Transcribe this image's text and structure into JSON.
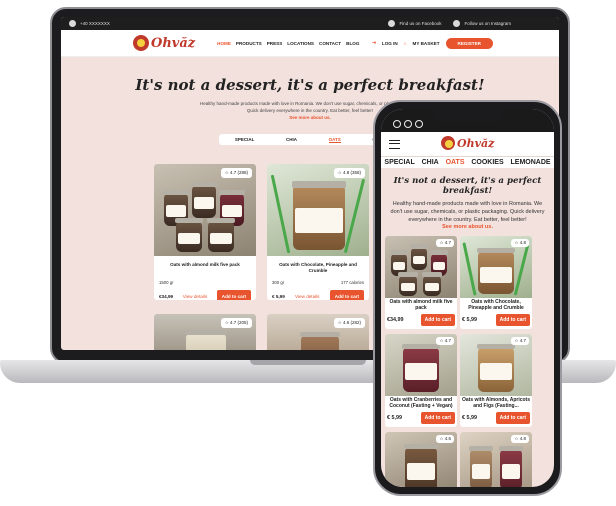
{
  "laptop": {
    "topbar": {
      "phone": "+40 XXXXXXX",
      "facebook": "Find us on Facebook",
      "instagram": "Follow us on Instagram"
    },
    "brand": "Ohvăz",
    "nav": [
      "HOME",
      "PRODUCTS",
      "PRESS",
      "LOCATIONS",
      "CONTACT",
      "BLOG"
    ],
    "nav_active": "HOME",
    "login": "LOG IN",
    "basket": "MY BASKET",
    "register": "REGISTER",
    "hero_title": "It's not a dessert, it's a perfect breakfast!",
    "hero_sub": "Healthy hand-made products made with love in Romania. We don't use sugar, chemicals, or plastic packaging. Quick delivery everywhere in the country. Eat better, feel better!",
    "hero_link": "See more about us.",
    "tabs": [
      "SPECIAL",
      "CHIA",
      "OATS",
      "COOKIES"
    ],
    "tab_active": "OATS",
    "cards": [
      {
        "rating": "4.7 (288)",
        "name": "Oats with almond milk five pack",
        "weight": "1500 gr",
        "calories": "",
        "price": "€34,99",
        "details": "View details",
        "add": "Add to cart"
      },
      {
        "rating": "4.8 (358)",
        "name": "Oats with Chocolate, Pineapple and Crumble",
        "weight": "300 gr",
        "calories": "177 calories",
        "price": "€ 5,99",
        "details": "View details",
        "add": "Add to cart"
      },
      {
        "rating": "4.7 (205)"
      },
      {
        "rating": "4.6 (282)"
      }
    ]
  },
  "phone": {
    "brand": "Ohvăz",
    "tabs": [
      "SPECIAL",
      "CHIA",
      "OATS",
      "COOKIES",
      "LEMONADE"
    ],
    "tab_active": "OATS",
    "hero_title": "It's not a dessert, it's a perfect breakfast!",
    "hero_sub": "Healthy hand-made products made with love in Romania. We don't use sugar, chemicals, or plastic packaging. Quick delivery everywhere in the country. Eat better, feel better!",
    "hero_link": "See more about us.",
    "cards": [
      {
        "rating": "4.7",
        "name": "Oats with almond milk five pack",
        "price": "€34,99",
        "add": "Add to cart"
      },
      {
        "rating": "4.8",
        "name": "Oats with Chocolate, Pineapple and Crumble",
        "price": "€ 5,99",
        "add": "Add to cart"
      },
      {
        "rating": "4.7",
        "name": "Oats with Cranberries and Coconut (Fasting + Vegan)",
        "price": "€ 5,99",
        "add": "Add to cart"
      },
      {
        "rating": "4.7",
        "name": "Oats with Almonds, Apricots and Figs (Fasting...",
        "price": "€ 5,99",
        "add": "Add to cart"
      },
      {
        "rating": "4.6"
      },
      {
        "rating": "4.8"
      }
    ]
  },
  "colors": {
    "accent": "#e8542e",
    "page_bg": "#f2e1dd",
    "brand_red": "#c0392b"
  }
}
